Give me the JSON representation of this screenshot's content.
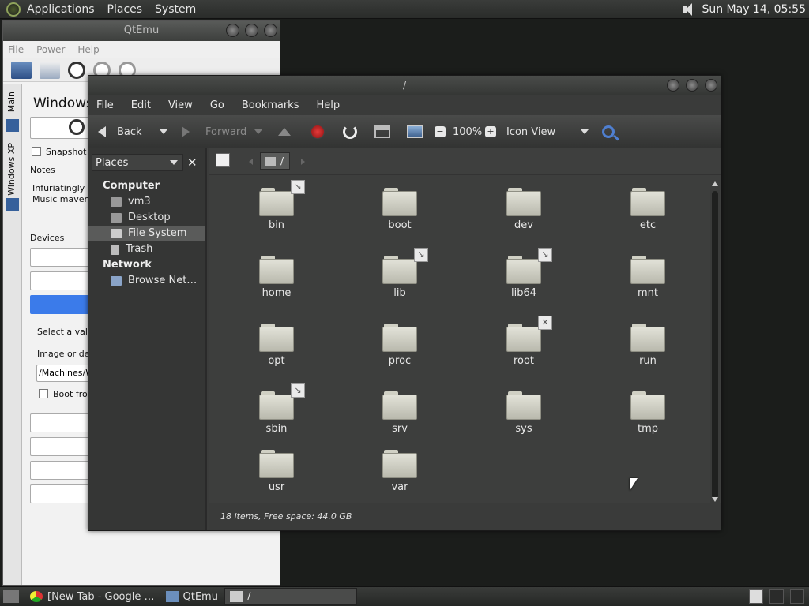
{
  "top_panel": {
    "menus": [
      "Applications",
      "Places",
      "System"
    ],
    "clock": "Sun May 14, 05:55"
  },
  "qtemu": {
    "title": "QtEmu",
    "menus": [
      "File",
      "Power",
      "Help"
    ],
    "side_tabs": [
      "Main",
      "Windows XP"
    ],
    "heading": "Windows",
    "snapshot_label": "Snapshot",
    "notes_label": "Notes",
    "notes_text_1": "Infuriatingly",
    "notes_text_2": "Music maven.",
    "devices_label": "Devices",
    "select_label": "Select a vali",
    "image_label": "Image or de",
    "path_value": "/Machines/W",
    "boot_label": "Boot from"
  },
  "fm": {
    "title": "/",
    "menus": [
      "File",
      "Edit",
      "View",
      "Go",
      "Bookmarks",
      "Help"
    ],
    "toolbar": {
      "back": "Back",
      "forward": "Forward",
      "zoom": "100%",
      "view_mode": "Icon View"
    },
    "sidebar": {
      "combo": "Places",
      "groups": [
        {
          "label": "Computer",
          "items": [
            "vm3",
            "Desktop",
            "File System",
            "Trash"
          ]
        },
        {
          "label": "Network",
          "items": [
            "Browse Net…"
          ]
        }
      ],
      "selected": "File System"
    },
    "location": "/",
    "files": [
      {
        "name": "bin",
        "emblem": "link"
      },
      {
        "name": "boot",
        "emblem": ""
      },
      {
        "name": "dev",
        "emblem": ""
      },
      {
        "name": "etc",
        "emblem": ""
      },
      {
        "name": "home",
        "emblem": ""
      },
      {
        "name": "lib",
        "emblem": "link"
      },
      {
        "name": "lib64",
        "emblem": "link"
      },
      {
        "name": "mnt",
        "emblem": ""
      },
      {
        "name": "opt",
        "emblem": ""
      },
      {
        "name": "proc",
        "emblem": ""
      },
      {
        "name": "root",
        "emblem": "locked"
      },
      {
        "name": "run",
        "emblem": ""
      },
      {
        "name": "sbin",
        "emblem": "link"
      },
      {
        "name": "srv",
        "emblem": ""
      },
      {
        "name": "sys",
        "emblem": ""
      },
      {
        "name": "tmp",
        "emblem": ""
      },
      {
        "name": "usr",
        "emblem": ""
      },
      {
        "name": "var",
        "emblem": ""
      }
    ],
    "status": "18 items, Free space: 44.0 GB"
  },
  "taskbar": {
    "tasks": [
      "[New Tab - Google …",
      "QtEmu",
      "/"
    ]
  }
}
